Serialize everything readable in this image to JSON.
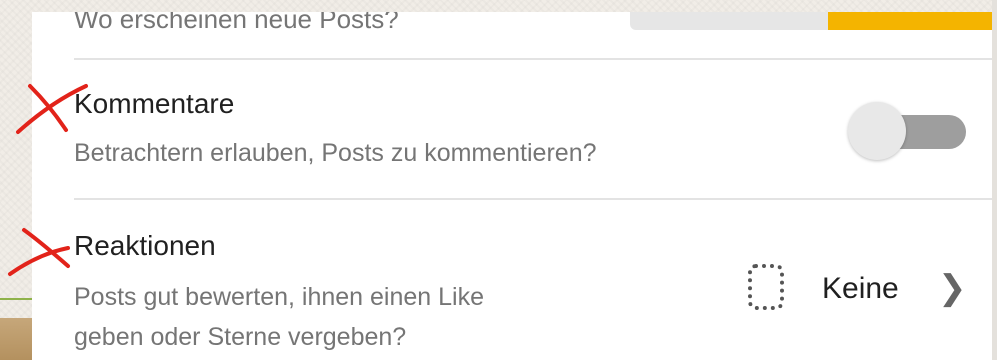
{
  "top_setting": {
    "subtitle": "Wo erscheinen neue Posts?",
    "slider_fill_percent": 48
  },
  "settings": [
    {
      "title": "Kommentare",
      "subtitle": "Betrachtern erlauben, Posts zu kommentieren?",
      "toggle_on": false
    },
    {
      "title": "Reaktionen",
      "subtitle_line1": "Posts gut bewerten, ihnen einen Like",
      "subtitle_line2": "geben oder Sterne vergeben?",
      "value": "Keine"
    }
  ],
  "icons": {
    "reaction": "dotted-square-icon",
    "chevron": "chevron-right-icon",
    "annotation": "red-cross-mark"
  },
  "colors": {
    "accent": "#f4b400",
    "annotation": "#e2231a"
  }
}
